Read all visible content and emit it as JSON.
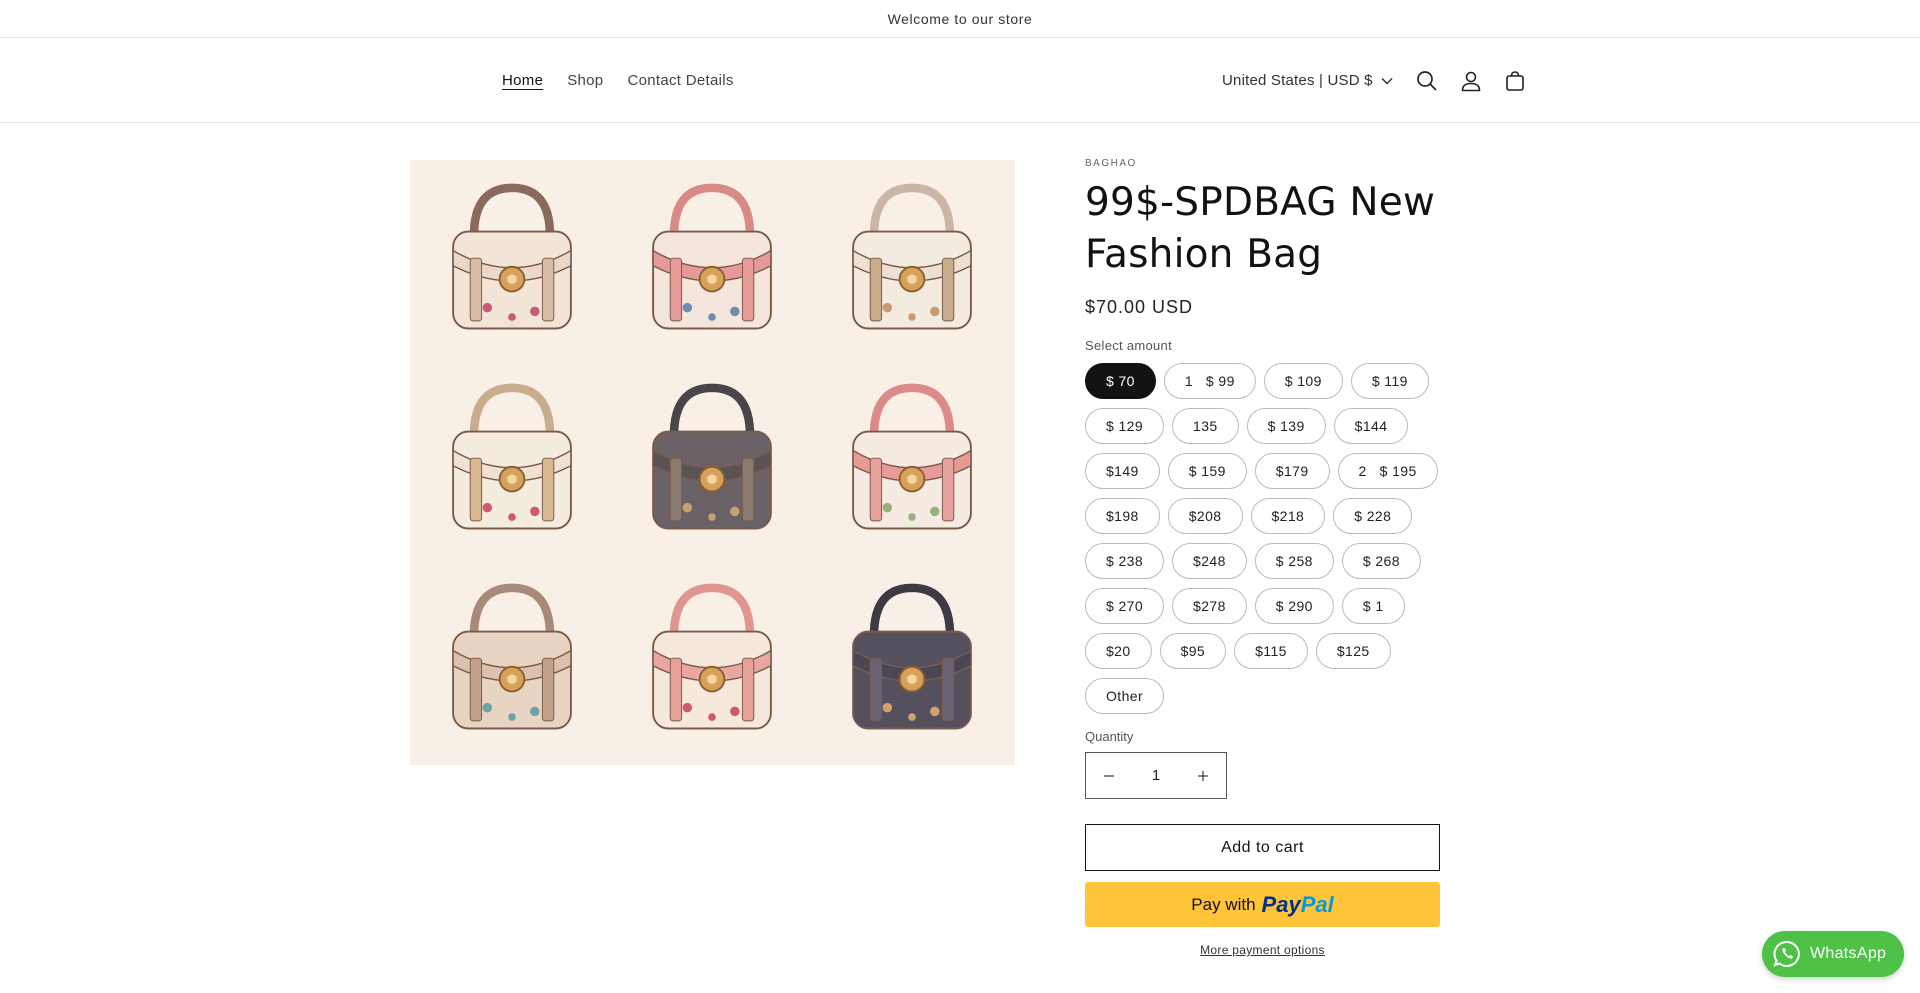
{
  "announcement": "Welcome to our store",
  "nav": {
    "home": "Home",
    "shop": "Shop",
    "contact": "Contact Details"
  },
  "header": {
    "country": "United States | USD $"
  },
  "product": {
    "vendor": "BAGHAO",
    "title": "99$-SPDBAG New Fashion Bag",
    "price": "$70.00 USD",
    "select_label": "Select amount",
    "amounts": [
      "$ 70",
      "1   $ 99",
      "$ 109",
      "$ 119",
      "$ 129",
      "135",
      "$ 139",
      "$144",
      "$149",
      "$ 159",
      "$179",
      "2   $ 195",
      "$198",
      "$208",
      "$218",
      "$ 228",
      "$ 238",
      "$248",
      "$ 258",
      "$ 268",
      "$ 270",
      "$278",
      "$ 290",
      "$ 1",
      "$20",
      "$95",
      "$115",
      "$125",
      "Other"
    ],
    "selected_index": 0,
    "quantity_label": "Quantity",
    "quantity": "1",
    "add_to_cart": "Add to cart",
    "paypal_prefix": "Pay with",
    "paypal_brand_1": "Pay",
    "paypal_brand_2": "Pal",
    "more_payment": "More payment options"
  },
  "whatsapp": "WhatsApp",
  "colors": {
    "accent": "#121212",
    "paypal": "#ffc439",
    "whatsapp": "#4dc247",
    "gallery_bg": "#f8efe7"
  },
  "icons": [
    "chevron-down-icon",
    "search-icon",
    "account-icon",
    "cart-icon",
    "minus-icon",
    "plus-icon",
    "whatsapp-icon"
  ]
}
